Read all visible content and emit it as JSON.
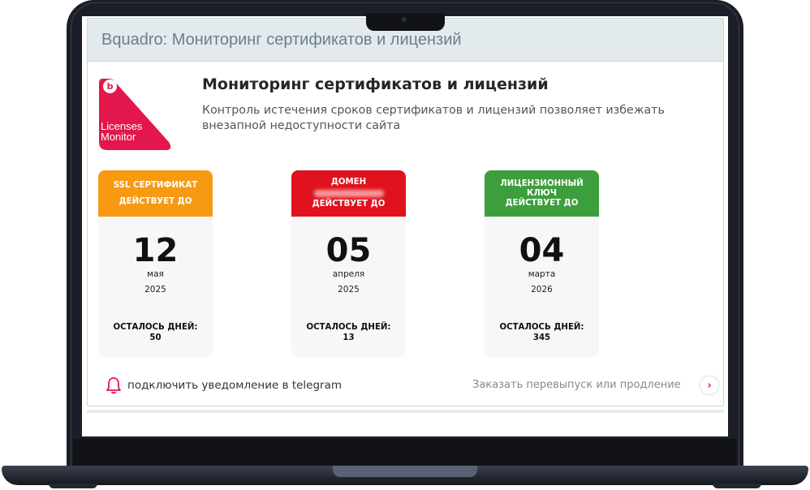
{
  "window": {
    "title": "Bquadro: Мониторинг сертификатов и лицензий"
  },
  "logo": {
    "badge_letter": "b",
    "line1": "Licenses",
    "line2": "Monitor"
  },
  "header": {
    "title": "Мониторинг сертификатов и лицензий",
    "description": "Контроль истечения сроков сертификатов и лицензий позволяет избежать внезапной недоступности сайта"
  },
  "cards": [
    {
      "line1": "SSL СЕРТИФИКАТ",
      "line2": "ДЕЙСТВУЕТ ДО",
      "day": "12",
      "month": "мая",
      "year": "2025",
      "left_label": "ОСТАЛОСЬ ДНЕЙ:",
      "left_value": "50"
    },
    {
      "line1": "ДОМЕН",
      "line2": "ДЕЙСТВУЕТ ДО",
      "day": "05",
      "month": "апреля",
      "year": "2025",
      "left_label": "ОСТАЛОСЬ ДНЕЙ:",
      "left_value": "13"
    },
    {
      "line1": "ЛИЦЕНЗИОННЫЙ",
      "line1b": "КЛЮЧ",
      "line2": "ДЕЙСТВУЕТ ДО",
      "day": "04",
      "month": "марта",
      "year": "2026",
      "left_label": "ОСТАЛОСЬ ДНЕЙ:",
      "left_value": "345"
    }
  ],
  "colors": {
    "ssl": "#f79a12",
    "domain": "#e0121d",
    "license": "#3d9e3d",
    "accent": "#e3174c"
  },
  "footer": {
    "telegram": "подключить уведомление в telegram",
    "order": "Заказать перевыпуск или продление",
    "order_arrow": "›"
  },
  "icons": {
    "bell": "bell-icon",
    "arrow": "chevron-right-icon"
  }
}
